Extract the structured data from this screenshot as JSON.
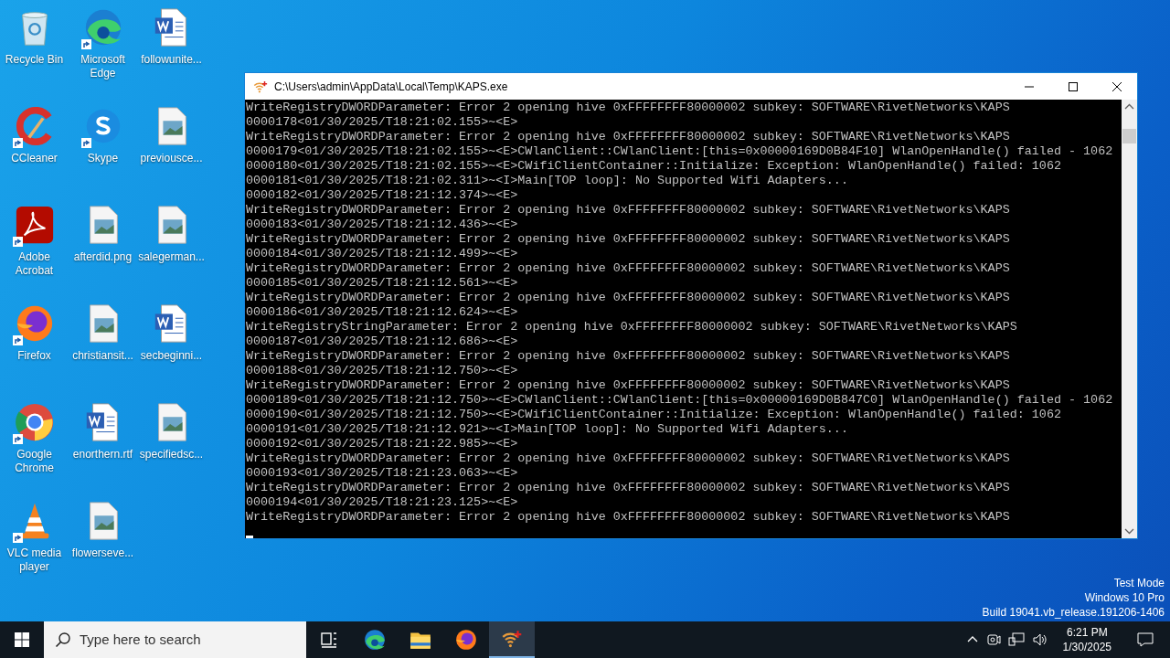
{
  "desktop": {
    "icons": [
      {
        "label": "Recycle Bin",
        "kind": "recycle",
        "shortcut": false
      },
      {
        "label": "CCleaner",
        "kind": "ccleaner",
        "shortcut": true
      },
      {
        "label": "Adobe Acrobat",
        "kind": "acrobat",
        "shortcut": true
      },
      {
        "label": "Firefox",
        "kind": "firefox",
        "shortcut": true
      },
      {
        "label": "Google Chrome",
        "kind": "chrome",
        "shortcut": true
      },
      {
        "label": "VLC media player",
        "kind": "vlc",
        "shortcut": true
      },
      {
        "label": "Microsoft Edge",
        "kind": "edge",
        "shortcut": true
      },
      {
        "label": "Skype",
        "kind": "skype",
        "shortcut": true
      },
      {
        "label": "afterdid.png",
        "kind": "image",
        "shortcut": false
      },
      {
        "label": "christiansit...",
        "kind": "image",
        "shortcut": false
      },
      {
        "label": "enorthern.rtf",
        "kind": "word",
        "shortcut": false
      },
      {
        "label": "flowerseve...",
        "kind": "image",
        "shortcut": false
      },
      {
        "label": "followunite...",
        "kind": "word",
        "shortcut": false
      },
      {
        "label": "previousce...",
        "kind": "image",
        "shortcut": false
      },
      {
        "label": "salegerman...",
        "kind": "image",
        "shortcut": false
      },
      {
        "label": "secbeginni...",
        "kind": "word",
        "shortcut": false
      },
      {
        "label": "specifiedsc...",
        "kind": "image",
        "shortcut": false
      }
    ]
  },
  "window": {
    "title": "C:\\Users\\admin\\AppData\\Local\\Temp\\KAPS.exe",
    "lines": [
      "WriteRegistryDWORDParameter: Error 2 opening hive 0xFFFFFFFF80000002 subkey: SOFTWARE\\RivetNetworks\\KAPS",
      "0000178<01/30/2025/T18:21:02.155>~<E>",
      "WriteRegistryDWORDParameter: Error 2 opening hive 0xFFFFFFFF80000002 subkey: SOFTWARE\\RivetNetworks\\KAPS",
      "0000179<01/30/2025/T18:21:02.155>~<E>CWlanClient::CWlanClient:[this=0x00000169D0B84F10] WlanOpenHandle() failed - 1062",
      "0000180<01/30/2025/T18:21:02.155>~<E>CWifiClientContainer::Initialize: Exception: WlanOpenHandle() failed: 1062",
      "0000181<01/30/2025/T18:21:02.311>~<I>Main[TOP loop]: No Supported Wifi Adapters...",
      "0000182<01/30/2025/T18:21:12.374>~<E>",
      "WriteRegistryDWORDParameter: Error 2 opening hive 0xFFFFFFFF80000002 subkey: SOFTWARE\\RivetNetworks\\KAPS",
      "0000183<01/30/2025/T18:21:12.436>~<E>",
      "WriteRegistryDWORDParameter: Error 2 opening hive 0xFFFFFFFF80000002 subkey: SOFTWARE\\RivetNetworks\\KAPS",
      "0000184<01/30/2025/T18:21:12.499>~<E>",
      "WriteRegistryDWORDParameter: Error 2 opening hive 0xFFFFFFFF80000002 subkey: SOFTWARE\\RivetNetworks\\KAPS",
      "0000185<01/30/2025/T18:21:12.561>~<E>",
      "WriteRegistryDWORDParameter: Error 2 opening hive 0xFFFFFFFF80000002 subkey: SOFTWARE\\RivetNetworks\\KAPS",
      "0000186<01/30/2025/T18:21:12.624>~<E>",
      "WriteRegistryStringParameter: Error 2 opening hive 0xFFFFFFFF80000002 subkey: SOFTWARE\\RivetNetworks\\KAPS",
      "0000187<01/30/2025/T18:21:12.686>~<E>",
      "WriteRegistryDWORDParameter: Error 2 opening hive 0xFFFFFFFF80000002 subkey: SOFTWARE\\RivetNetworks\\KAPS",
      "0000188<01/30/2025/T18:21:12.750>~<E>",
      "WriteRegistryDWORDParameter: Error 2 opening hive 0xFFFFFFFF80000002 subkey: SOFTWARE\\RivetNetworks\\KAPS",
      "0000189<01/30/2025/T18:21:12.750>~<E>CWlanClient::CWlanClient:[this=0x00000169D0B847C0] WlanOpenHandle() failed - 1062",
      "0000190<01/30/2025/T18:21:12.750>~<E>CWifiClientContainer::Initialize: Exception: WlanOpenHandle() failed: 1062",
      "0000191<01/30/2025/T18:21:12.921>~<I>Main[TOP loop]: No Supported Wifi Adapters...",
      "0000192<01/30/2025/T18:21:22.985>~<E>",
      "WriteRegistryDWORDParameter: Error 2 opening hive 0xFFFFFFFF80000002 subkey: SOFTWARE\\RivetNetworks\\KAPS",
      "0000193<01/30/2025/T18:21:23.063>~<E>",
      "WriteRegistryDWORDParameter: Error 2 opening hive 0xFFFFFFFF80000002 subkey: SOFTWARE\\RivetNetworks\\KAPS",
      "0000194<01/30/2025/T18:21:23.125>~<E>",
      "WriteRegistryDWORDParameter: Error 2 opening hive 0xFFFFFFFF80000002 subkey: SOFTWARE\\RivetNetworks\\KAPS"
    ]
  },
  "system_notice": [
    "Test Mode",
    "Windows 10 Pro",
    "Build 19041.vb_release.191206-1406"
  ],
  "taskbar": {
    "search": {
      "placeholder": "Type here to search"
    },
    "apps": [
      {
        "kind": "taskview",
        "active": false
      },
      {
        "kind": "edge",
        "active": false
      },
      {
        "kind": "explorer",
        "active": false
      },
      {
        "kind": "firefox",
        "active": false
      },
      {
        "kind": "kaps",
        "active": true
      }
    ],
    "clock": {
      "time": "6:21 PM",
      "date": "1/30/2025"
    }
  }
}
